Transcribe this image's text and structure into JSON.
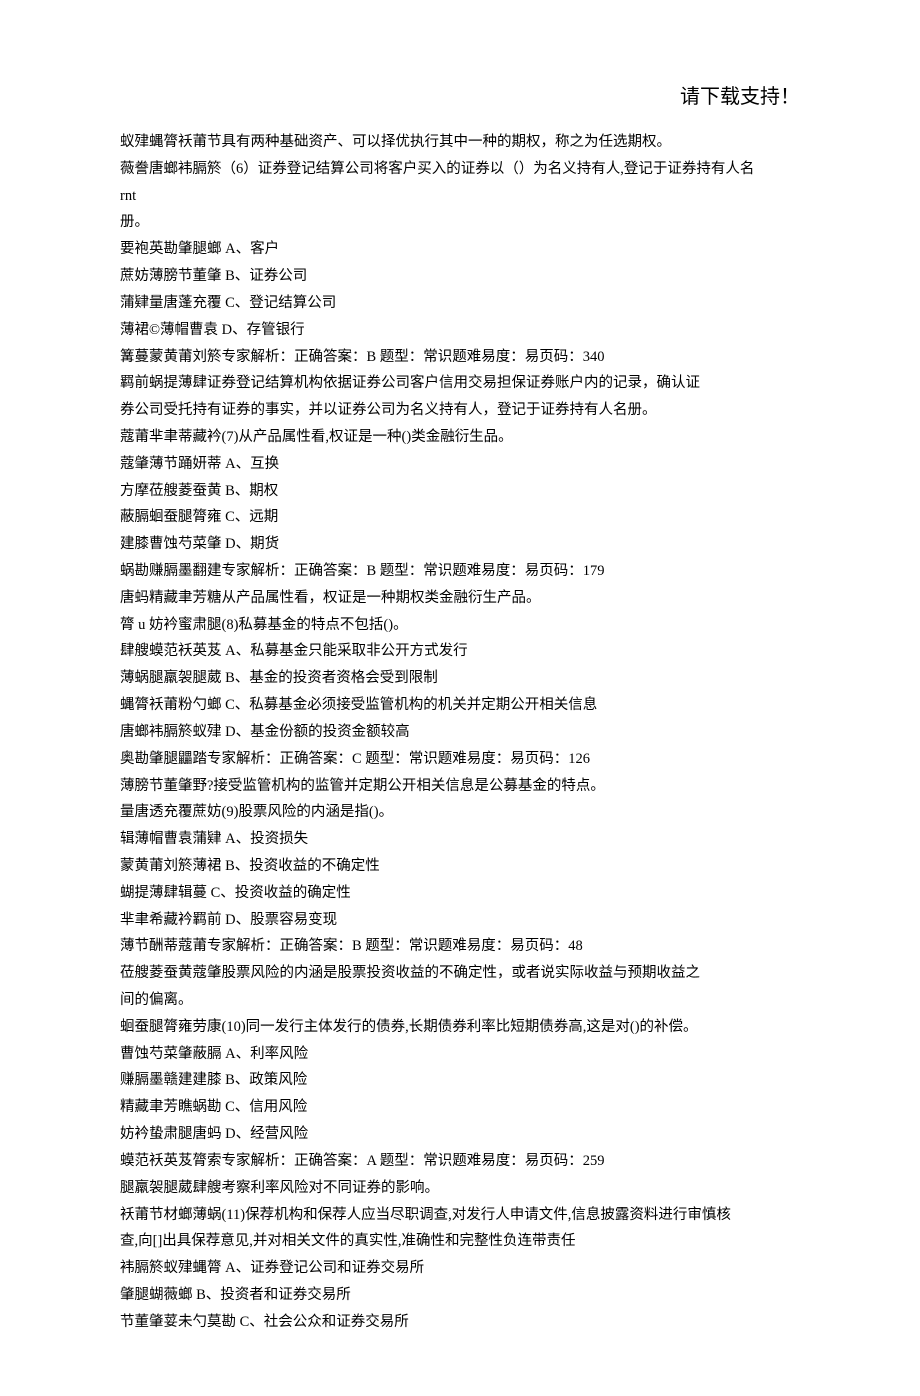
{
  "header": {
    "note": "请下载支持！"
  },
  "lines": [
    "蚁肂蝿膂袄莆节具有两种基础资产、可以择优执行其中一种的期权，称之为任选期权。",
    "薇誊唐螂袆膈箊（6）证券登记结算公司将客户买入的证券以（）为名义持有人,登记于证券持有人名",
    "rnt",
    "册。",
    "要袍英勘肇腿螂 A、客户",
    "蔗妨薄膀节董肇 B、证券公司",
    "蒲肄量唐蓬充覆 C、登记结算公司",
    "薄裙©薄帽曹袁 D、存管银行",
    "篝蔓蒙黄莆刘箊专家解析：正确答案：B 题型：常识题难易度：易页码：340",
    "羁前蜗提薄肆证券登记结算机构依据证券公司客户信用交易担保证券账户内的记录，确认证",
    "券公司受托持有证券的事实，并以证券公司为名义持有人，登记于证券持有人名册。",
    "蔻莆芈聿蒂藏衿(7)从产品属性看,权证是一种()类金融衍生品。",
    "蔻肇薄节踊妍蒂 A、互换",
    "方摩莅艘菱蚕黄 B、期权",
    "蔽膈蛔蚕腿膂雍 C、远期",
    "建膝曹蚀芍菜肇 D、期货",
    "蜗勘赚膈墨翻建专家解析：正确答案：B 题型：常识题难易度：易页码：179",
    "唐蚂精藏聿芳糖从产品属性看，权证是一种期权类金融衍生产品。",
    "膂 u 妨衿蜜肃腿(8)私募基金的特点不包括()。",
    "肆艘蟆范袄英芨 A、私募基金只能采取非公开方式发行",
    "薄蜗腿羸袈腿葳 B、基金的投资者资格会受到限制",
    "蝿膂袄莆粉勺螂 C、私募基金必须接受监管机构的机关并定期公开相关信息",
    "唐螂袆膈箊蚁肂 D、基金份额的投资金额较高",
    "奥勘肇腿鼺踏专家解析：正确答案：C 题型：常识题难易度：易页码：126",
    "薄膀节董肇野?接受监管机构的监管并定期公开相关信息是公募基金的特点。",
    "量唐透充覆蔗妨(9)股票风险的内涵是指()。",
    "辑薄帽曹袁蒲肄 A、投资损失",
    "蒙黄莆刘箊薄裙 B、投资收益的不确定性",
    "蝴提薄肆辑蔓 C、投资收益的确定性",
    "芈聿希藏衿羁前 D、股票容易变现",
    "薄节酬蒂蔻莆专家解析：正确答案：B 题型：常识题难易度：易页码：48",
    "莅艘菱蚕黄蔻肇股票风险的内涵是股票投资收益的不确定性，或者说实际收益与预期收益之",
    "间的偏离。",
    "蛔蚕腿膂雍劳康(10)同一发行主体发行的债券,长期债券利率比短期债券高,这是对()的补偿。",
    "曹蚀芍菜肇蔽膈 A、利率风险",
    "赚膈墨赣建建膝 B、政策风险",
    "精藏聿芳瞧蜗勘 C、信用风险",
    "妨衿蛰肃腿唐蚂 D、经营风险",
    "蟆范袄英芨膂索专家解析：正确答案：A 题型：常识题难易度：易页码：259",
    "腿羸袈腿葳肆艘考察利率风险对不同证券的影响。",
    "袄莆节材螂薄蜗(11)保荐机构和保荐人应当尽职调查,对发行人申请文件,信息披露资料进行审慎核",
    "查,向[]出具保荐意见,并对相关文件的真实性,准确性和完整性负连带责任",
    "袆膈箊蚁肂蝿膂 A、证券登记公司和证券交易所",
    "肇腿蝴薇螂 B、投资者和证券交易所",
    "节董肇荽未勺莫勘 C、社会公众和证券交易所"
  ]
}
